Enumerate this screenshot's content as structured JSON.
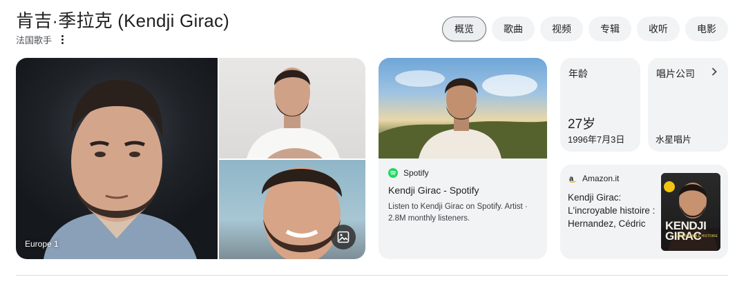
{
  "header": {
    "title": "肯吉·季拉克 (Kendji Girac)",
    "subtitle": "法国歌手"
  },
  "tabs": [
    {
      "label": "概览",
      "active": true
    },
    {
      "label": "歌曲",
      "active": false
    },
    {
      "label": "视频",
      "active": false
    },
    {
      "label": "专辑",
      "active": false
    },
    {
      "label": "收听",
      "active": false
    },
    {
      "label": "电影",
      "active": false
    }
  ],
  "photos": {
    "main_caption": "Europe 1"
  },
  "spotify_card": {
    "source": "Spotify",
    "title": "Kendji Girac - Spotify",
    "description": "Listen to Kendji Girac on Spotify. Artist · 2.8M monthly listeners.",
    "icon": "spotify-icon",
    "brand_color": "#1ed760"
  },
  "age_card": {
    "label": "年龄",
    "value": "27岁",
    "detail": "1996年7月3日"
  },
  "label_card": {
    "label": "唱片公司",
    "value": "水星唱片"
  },
  "amazon_card": {
    "source": "Amazon.it",
    "title": "Kendji Girac: L'incroyable histoire : Hernandez, Cédric",
    "book_cover": {
      "name_line1": "KENDJI",
      "name_line2": "GIRAC",
      "subtitle": "L'INCROYABLE HISTOIRE"
    }
  }
}
